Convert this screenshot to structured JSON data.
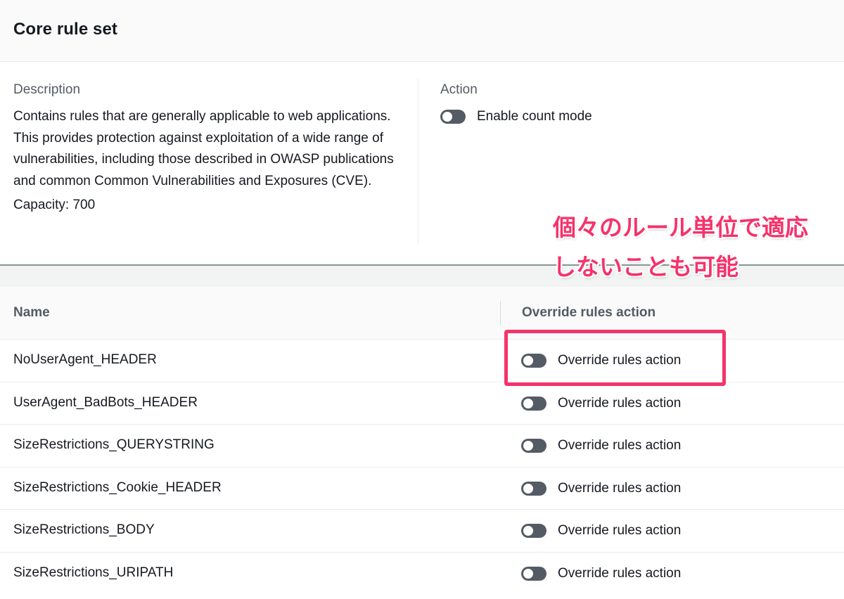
{
  "panel": {
    "title": "Core rule set"
  },
  "details": {
    "description_label": "Description",
    "description_text": "Contains rules that are generally applicable to web applications. This provides protection against exploitation of a wide range of vulnerabilities, including those described in OWASP publications and common Common Vulnerabilities and Exposures (CVE).",
    "capacity": "Capacity: 700",
    "action_label": "Action",
    "count_mode_label": "Enable count mode",
    "count_mode_enabled": false
  },
  "table": {
    "columns": {
      "name": "Name",
      "override": "Override rules action"
    },
    "rows": [
      {
        "name": "NoUserAgent_HEADER",
        "override_label": "Override rules action",
        "enabled": false
      },
      {
        "name": "UserAgent_BadBots_HEADER",
        "override_label": "Override rules action",
        "enabled": false
      },
      {
        "name": "SizeRestrictions_QUERYSTRING",
        "override_label": "Override rules action",
        "enabled": false
      },
      {
        "name": "SizeRestrictions_Cookie_HEADER",
        "override_label": "Override rules action",
        "enabled": false
      },
      {
        "name": "SizeRestrictions_BODY",
        "override_label": "Override rules action",
        "enabled": false
      },
      {
        "name": "SizeRestrictions_URIPATH",
        "override_label": "Override rules action",
        "enabled": false
      }
    ]
  },
  "annotation": {
    "line1": "個々のルール単位で適応",
    "line2": "しないことも可能",
    "color": "#f5336b"
  },
  "colors": {
    "toggle_off": "#545b64",
    "text": "#16191f",
    "muted": "#545b64"
  },
  "icons": {
    "toggle": "toggle-switch-icon"
  }
}
